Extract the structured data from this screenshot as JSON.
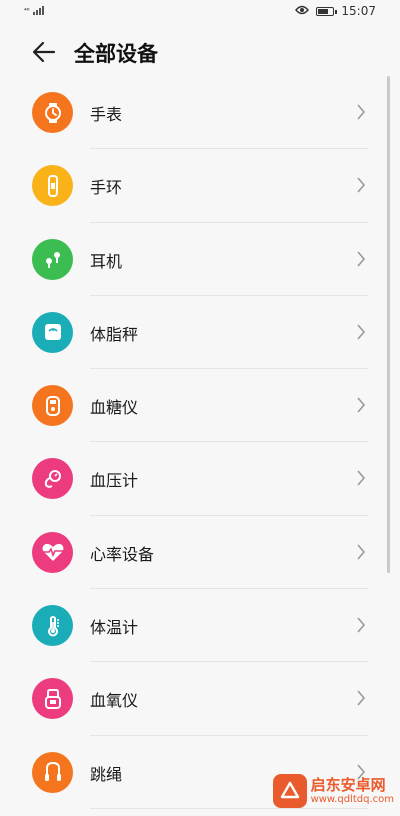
{
  "status_bar": {
    "network": "⁴⁶",
    "time": "15:07",
    "battery_level": 0.7
  },
  "header": {
    "title": "全部设备",
    "back_icon": "arrow-left-icon"
  },
  "devices": [
    {
      "label": "手表",
      "icon": "watch-icon",
      "color": "#f5751e"
    },
    {
      "label": "手环",
      "icon": "band-icon",
      "color": "#f9b318"
    },
    {
      "label": "耳机",
      "icon": "earphones-icon",
      "color": "#3cbd51"
    },
    {
      "label": "体脂秤",
      "icon": "scale-icon",
      "color": "#1aadb8"
    },
    {
      "label": "血糖仪",
      "icon": "glucose-meter-icon",
      "color": "#f5751e"
    },
    {
      "label": "血压计",
      "icon": "blood-pressure-icon",
      "color": "#ec3b7e"
    },
    {
      "label": "心率设备",
      "icon": "heart-rate-icon",
      "color": "#ec3b7e"
    },
    {
      "label": "体温计",
      "icon": "thermometer-icon",
      "color": "#1aadb8"
    },
    {
      "label": "血氧仪",
      "icon": "oximeter-icon",
      "color": "#ec3b7e"
    },
    {
      "label": "跳绳",
      "icon": "jump-rope-icon",
      "color": "#f5751e"
    }
  ],
  "watermark": {
    "name": "启东安卓网",
    "url": "www.qdltdq.com"
  }
}
